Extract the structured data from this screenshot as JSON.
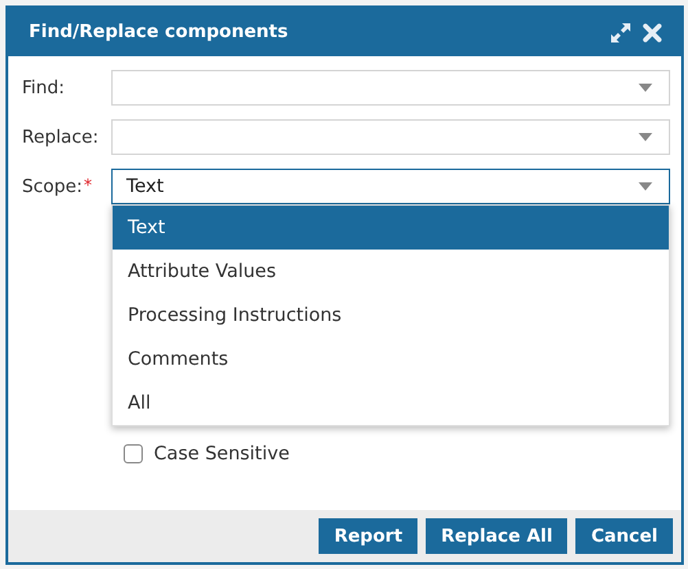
{
  "window": {
    "title": "Find/Replace components"
  },
  "fields": [
    {
      "label": "Find:"
    },
    {
      "label": "Replace:"
    },
    {
      "label": "Scope:",
      "required_mark": "*",
      "value": "Text",
      "expanded": true
    }
  ],
  "scope_options": [
    {
      "label": "Text",
      "selected": true
    },
    {
      "label": "Attribute Values",
      "selected": false
    },
    {
      "label": "Processing Instructions",
      "selected": false
    },
    {
      "label": "Comments",
      "selected": false
    },
    {
      "label": "All",
      "selected": false
    }
  ],
  "options": [
    {
      "label": "Case Sensitive",
      "checked": false
    }
  ],
  "buttons": [
    {
      "label": "Report"
    },
    {
      "label": "Replace All"
    },
    {
      "label": "Cancel"
    }
  ]
}
